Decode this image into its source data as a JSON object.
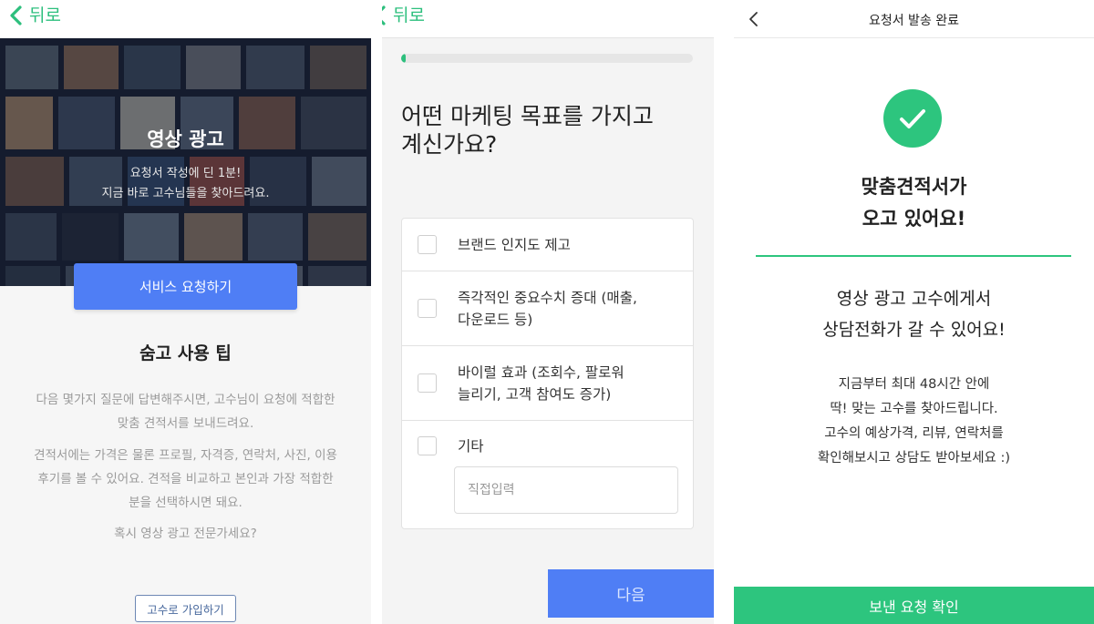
{
  "screen1": {
    "back_label": "뒤로",
    "hero": {
      "title": "영상 광고",
      "subtitle_line1": "요청서 작성에 딘 1분!",
      "subtitle_line2": "지금 바로 고수님들을 찾아드려요."
    },
    "request_button": "서비스 요청하기",
    "tips": {
      "title": "숨고 사용 팁",
      "p1_line1": "다음 몇가지 질문에 답변해주시면, 고수님이 요청에 적합한",
      "p1_line2": "맞춤 견적서를 보내드려요.",
      "p2_line1": "견적서에는 가격은 물론 프로필, 자격증, 연락처, 사진, 이용",
      "p2_line2": "후기를 볼 수 있어요. 견적을 비교하고 본인과 가장 적합한",
      "p2_line3": "분을 선택하시면 돼요.",
      "p3": "혹시 영상 광고 전문가세요?"
    },
    "join_button": "고수로 가입하기"
  },
  "screen2": {
    "back_label": "뒤로",
    "progress_fraction": 0.01,
    "question_line1": "어떤 마케팅 목표를 가지고",
    "question_line2": "계신가요?",
    "options": [
      {
        "line1": "브랜드 인지도 제고",
        "line2": ""
      },
      {
        "line1": "즉각적인 중요수치 증대 (매출,",
        "line2": "다운로드 등)"
      },
      {
        "line1": "바이럴 효과 (조회수, 팔로워",
        "line2": "늘리기, 고객 참여도 증가)"
      },
      {
        "line1": "기타",
        "line2": ""
      }
    ],
    "direct_input_placeholder": "직접입력",
    "next_button": "다음"
  },
  "screen3": {
    "title": "요청서 발송 완료",
    "headline_line1": "맞춤견적서가",
    "headline_line2": "오고 있어요!",
    "message_line1": "영상 광고 고수에게서",
    "message_line2": "상담전화가 갈 수 있어요!",
    "desc_line1": "지금부터 최대 48시간 안에",
    "desc_line2": "딱! 맞는 고수를 찾아드립니다.",
    "desc_line3": "고수의 예상가격, 리뷰, 연락처를",
    "desc_line4": "확인해보시고 상담도 받아보세요 :)",
    "confirm_button": "보낸 요청 확인"
  },
  "colors": {
    "brand_green": "#2dc57e",
    "primary_blue": "#4f7ef5",
    "link_blue": "#4a6a9e"
  },
  "icons": [
    "chevron-left-icon",
    "check-icon",
    "checkbox-icon"
  ]
}
